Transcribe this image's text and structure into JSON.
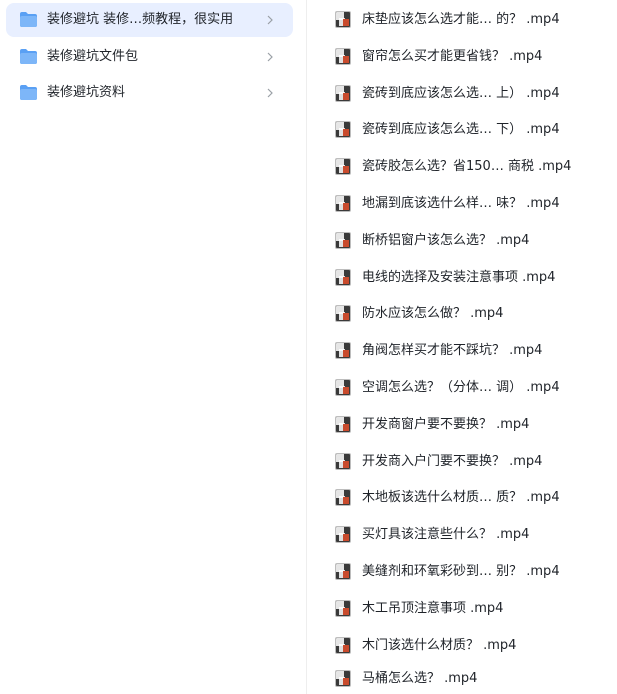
{
  "folders": [
    {
      "label": "装修避坑 装修…频教程，很实用",
      "selected": true
    },
    {
      "label": "装修避坑文件包",
      "selected": false
    },
    {
      "label": "装修避坑资料",
      "selected": false
    }
  ],
  "files": [
    "床垫应该怎么选才能…  的？ .mp4",
    "窗帘怎么买才能更省钱？ .mp4",
    "瓷砖到底应该怎么选…  上） .mp4",
    "瓷砖到底应该怎么选…  下） .mp4",
    "瓷砖胶怎么选？省150…  商税 .mp4",
    "地漏到底该选什么样…  味？ .mp4",
    "断桥铝窗户该怎么选？ .mp4",
    "电线的选择及安装注意事项 .mp4",
    "防水应该怎么做？ .mp4",
    "角阀怎样买才能不踩坑？ .mp4",
    "空调怎么选？（分体…  调） .mp4",
    "开发商窗户要不要换？ .mp4",
    "开发商入户门要不要换？ .mp4",
    "木地板该选什么材质…  质？ .mp4",
    "买灯具该注意些什么？ .mp4",
    "美缝剂和环氧彩砂到…  别？ .mp4",
    "木工吊顶注意事项 .mp4",
    "木门该选什么材质？ .mp4",
    "马桶怎么选？ .mp4"
  ],
  "colors": {
    "selected_bg": "#e8efff",
    "folder_blue": "#5aa0f4",
    "text": "#1f2329",
    "chevron": "#9aa0a6"
  }
}
